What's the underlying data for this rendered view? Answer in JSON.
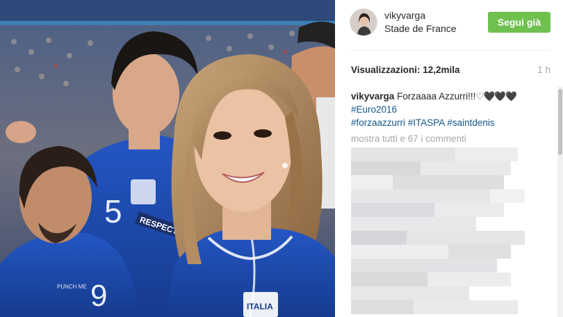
{
  "post": {
    "username": "vikyvarga",
    "location": "Stade de France",
    "follow_label": "Segui già",
    "views_label": "Visualizzazioni: 12,2mila",
    "time_ago": "1 h"
  },
  "caption": {
    "user": "vikyvarga",
    "text": "Forzaaaa Azzurri!!!",
    "emoji": "♡🖤🖤🖤",
    "hashtags_line1": [
      "#Euro2016"
    ],
    "hashtags_line2": [
      "#forzaazzurri",
      "#ITASPA",
      "#saintdenis"
    ]
  },
  "show_all_comments": "mostra tutti e 67 i commenti",
  "photo": {
    "jersey_text": "RESPECT",
    "badge_text": "ITALIA",
    "cutout_number": "9",
    "cutout_small_text": "PUNCH ME"
  },
  "colors": {
    "follow_green": "#70c050",
    "hashtag_blue": "#125688",
    "muted_gray": "#a5a7aa",
    "jersey_blue": "#1f4fb8"
  }
}
